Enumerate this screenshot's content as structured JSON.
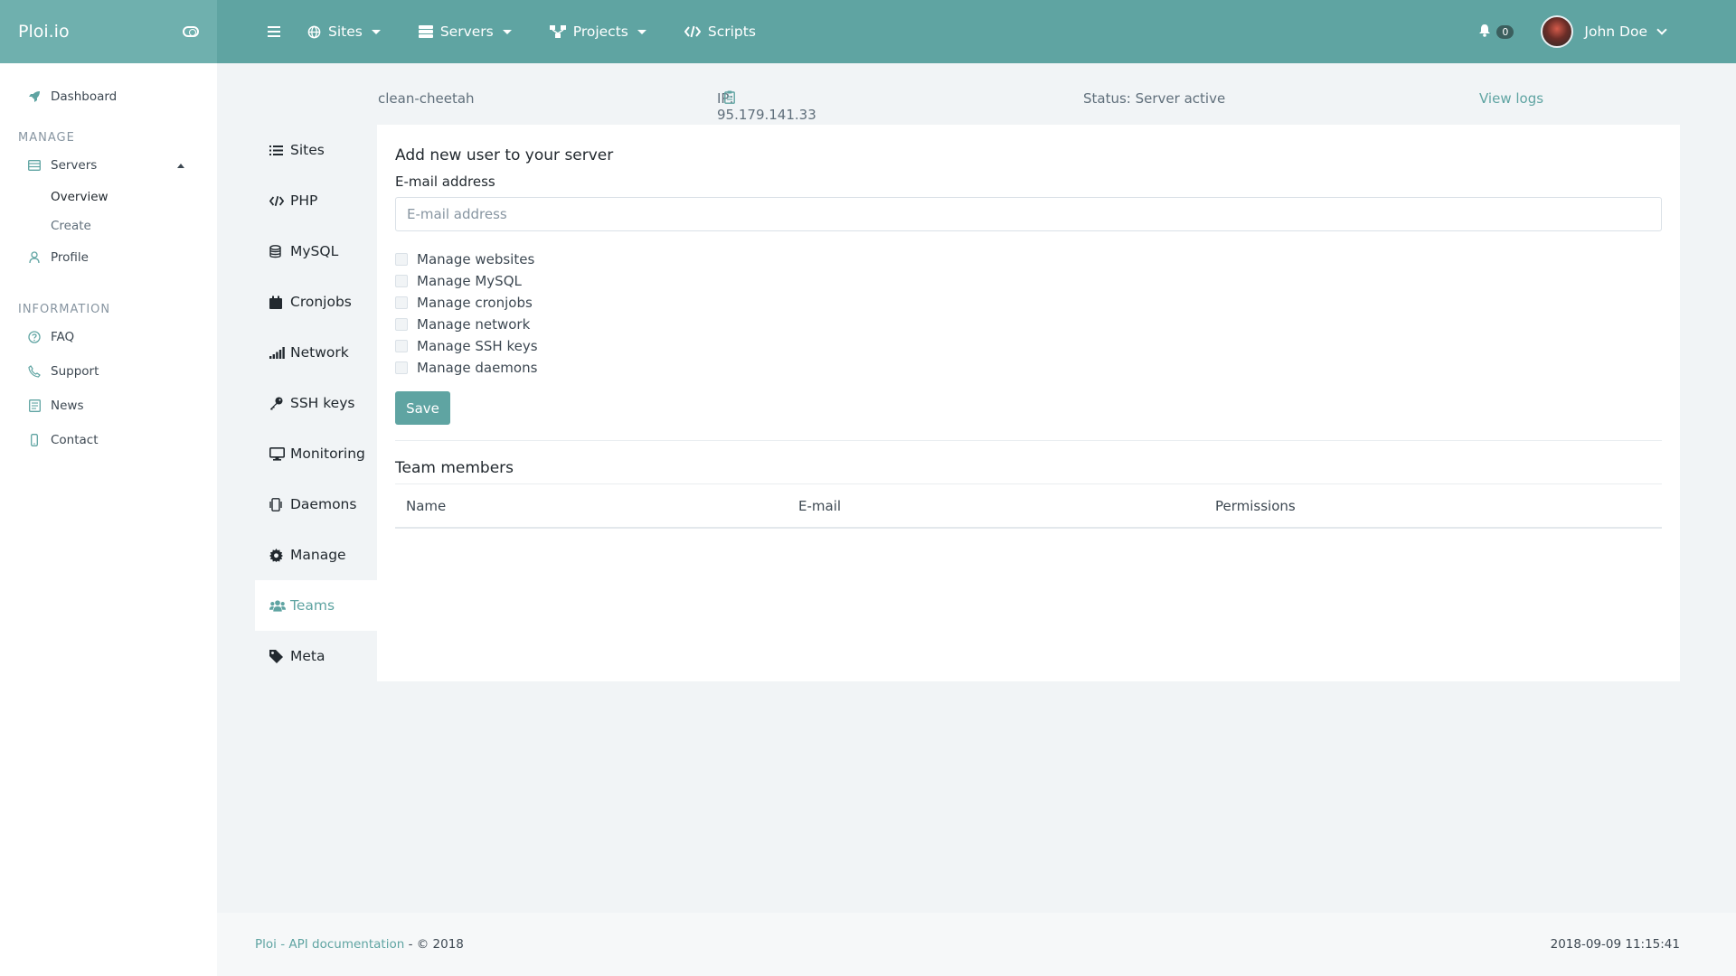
{
  "brand": {
    "name": "Ploi.io"
  },
  "topnav": {
    "items": [
      {
        "label": "Sites",
        "icon": "globe-icon",
        "dropdown": true
      },
      {
        "label": "Servers",
        "icon": "server-icon",
        "dropdown": true
      },
      {
        "label": "Projects",
        "icon": "sitemap-icon",
        "dropdown": true
      },
      {
        "label": "Scripts",
        "icon": "code-icon",
        "dropdown": false
      }
    ],
    "notifications": "0",
    "user": "John Doe"
  },
  "sidebar": {
    "dashboard": "Dashboard",
    "manage_heading": "MANAGE",
    "servers": "Servers",
    "overview": "Overview",
    "create": "Create",
    "profile": "Profile",
    "information_heading": "INFORMATION",
    "faq": "FAQ",
    "support": "Support",
    "news": "News",
    "contact": "Contact"
  },
  "server": {
    "name": "clean-cheetah",
    "ip": "IP: 95.179.141.33",
    "status": "Status: Server active",
    "view_logs": "View logs"
  },
  "submenu": {
    "items": [
      {
        "label": "Sites",
        "icon": "list-icon"
      },
      {
        "label": "PHP",
        "icon": "code-icon"
      },
      {
        "label": "MySQL",
        "icon": "database-icon"
      },
      {
        "label": "Cronjobs",
        "icon": "calendar-icon"
      },
      {
        "label": "Network",
        "icon": "signal-icon"
      },
      {
        "label": "SSH keys",
        "icon": "key-icon"
      },
      {
        "label": "Monitoring",
        "icon": "desktop-icon"
      },
      {
        "label": "Daemons",
        "icon": "mobile-icon"
      },
      {
        "label": "Manage",
        "icon": "cog-icon"
      },
      {
        "label": "Teams",
        "icon": "users-icon",
        "active": true
      },
      {
        "label": "Meta",
        "icon": "tag-icon"
      }
    ]
  },
  "form": {
    "title": "Add new user to your server",
    "email_label": "E-mail address",
    "email_placeholder": "E-mail address",
    "email_value": "",
    "permissions": [
      "Manage websites",
      "Manage MySQL",
      "Manage cronjobs",
      "Manage network",
      "Manage SSH keys",
      "Manage daemons"
    ],
    "save": "Save"
  },
  "team": {
    "title": "Team members",
    "columns": [
      "Name",
      "E-mail",
      "Permissions"
    ]
  },
  "footer": {
    "ploi": "Ploi",
    "sep1": " - ",
    "api_docs": "API documentation",
    "copyright": " - © 2018",
    "timestamp": "2018-09-09 11:15:41"
  },
  "colors": {
    "accent": "#5fa4a2",
    "brand_bg": "#6fb0ae",
    "page_bg": "#f1f4f6"
  }
}
